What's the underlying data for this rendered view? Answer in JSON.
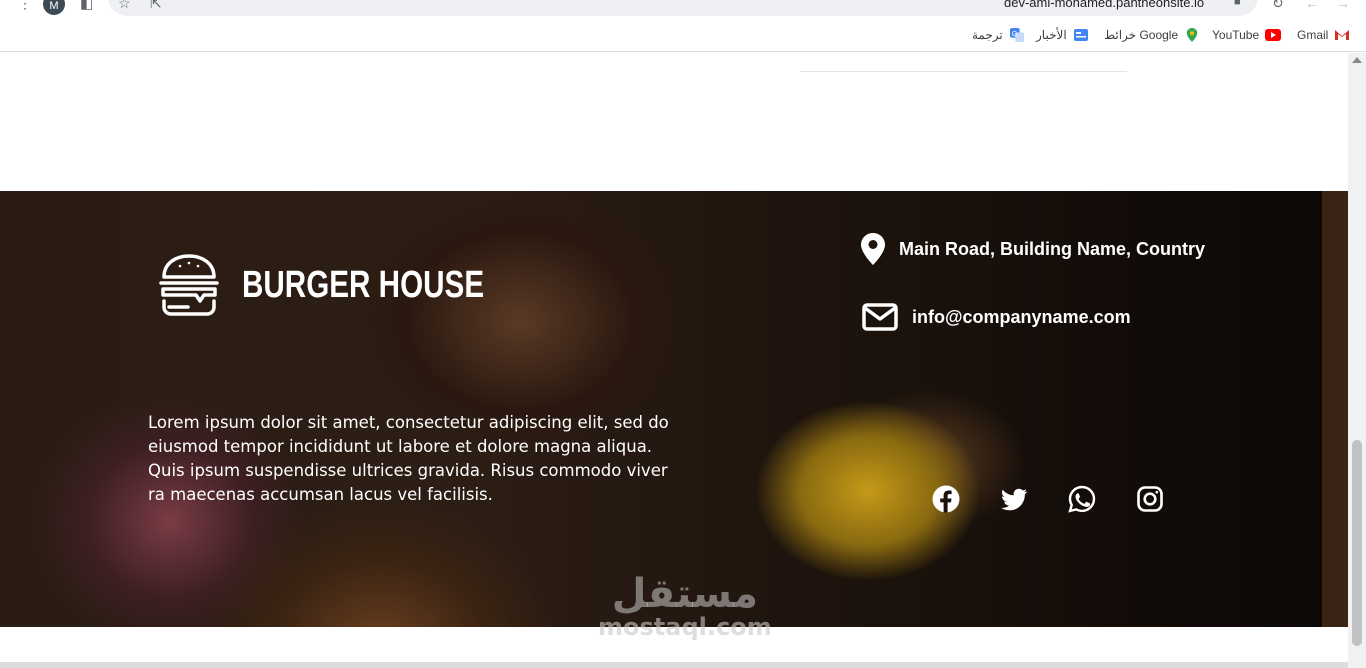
{
  "browser": {
    "url": "dev-ami-mohamed.pantheonsite.io",
    "avatar_letter": "M",
    "bookmarks": [
      {
        "label": "Gmail",
        "icon": "gmail-icon",
        "color": "#d93025"
      },
      {
        "label": "YouTube",
        "icon": "youtube-icon",
        "color": "#ff0000"
      },
      {
        "label": "خرائط Google",
        "icon": "maps-icon",
        "color": "#34a853"
      },
      {
        "label": "الأخبار",
        "icon": "news-icon",
        "color": "#4285f4"
      },
      {
        "label": "ترجمة",
        "icon": "translate-icon",
        "color": "#4285f4"
      }
    ]
  },
  "footer": {
    "brand": "BURGER HOUSE",
    "about": "Lorem ipsum dolor sit amet, consectetur adipiscing elit, sed do eiusmod tempor incididunt ut labore et dolore magna aliqua. Quis ipsum suspendisse ultrices gravida. Risus commodo viver ra maecenas accumsan lacus vel facilisis.",
    "address": "Main Road, Building Name, Country",
    "email": "info@companyname.com",
    "socials": [
      "facebook-icon",
      "twitter-icon",
      "whatsapp-icon",
      "instagram-icon"
    ]
  },
  "watermark": {
    "arabic": "مستقل",
    "latin": "mostaql.com"
  }
}
